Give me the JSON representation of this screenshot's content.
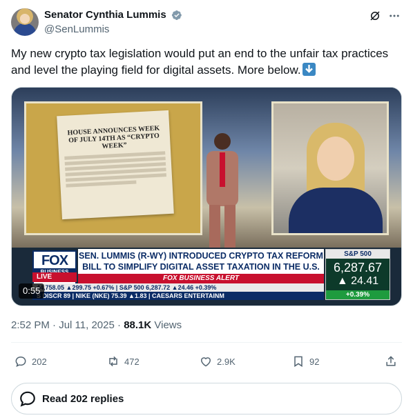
{
  "author": {
    "display_name": "Senator Cynthia Lummis",
    "handle": "@SenLummis"
  },
  "tweet": {
    "text": "My new crypto tax legislation would put an end to the unfair tax practices and level the playing field for digital assets. More below.",
    "emoji": "arrow-down-emoji"
  },
  "media": {
    "duration": "0:55",
    "doc_title": "HOUSE ANNOUNCES WEEK OF JULY 14TH AS “CRYPTO WEEK”",
    "fox_logo": "FOX",
    "fox_sub": "BUSINESS",
    "live": "LIVE",
    "headline": "SEN. LUMMIS (R-WY) INTRODUCED CRYPTO TAX REFORM BILL TO SIMPLIFY DIGITAL ASSET TAXATION IN THE U.S.",
    "alert": "FOX BUSINESS ALERT",
    "ticker1": "44,758.05 ▲299.75 +0.67% | S&P 500   6,287.72 ▲24.46 +0.39%",
    "ticker2": "S DISCR  89  |  NIKE (NKE)  75.39 ▲1.83  |  CAESARS ENTERTAINM",
    "sp_title": "S&P 500",
    "sp_value": "6,287.67",
    "sp_change": "▲ 24.41",
    "sp_pct": "+0.39%"
  },
  "meta": {
    "time": "2:52 PM",
    "separator": "·",
    "date": "Jul 11, 2025",
    "views_count": "88.1K",
    "views_label": "Views"
  },
  "actions": {
    "replies": "202",
    "reposts": "472",
    "likes": "2.9K",
    "bookmarks": "92"
  },
  "read_replies": "Read 202 replies",
  "colors": {
    "accent": "#1d9bf0",
    "secondary_text": "#536471",
    "border": "#cfd9de"
  }
}
